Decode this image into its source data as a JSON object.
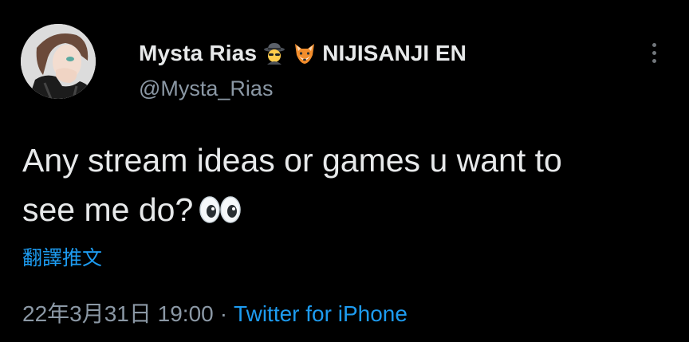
{
  "author": {
    "display_name": "Mysta Rias",
    "name_emojis": [
      "detective-emoji-icon",
      "fox-emoji-icon"
    ],
    "name_suffix": "NIJISANJI EN",
    "handle": "@Mysta_Rias"
  },
  "tweet": {
    "text_line1": "Any stream ideas or games u want to",
    "text_line2": "see me do?",
    "trailing_emoji": "eyes-emoji-icon"
  },
  "translate_label": "翻譯推文",
  "meta": {
    "timestamp": "22年3月31日 19:00",
    "separator": "·",
    "source": "Twitter for iPhone"
  },
  "colors": {
    "background": "#000000",
    "text": "#e7e9ea",
    "secondary": "#8b98a5",
    "link": "#1d9bf0"
  }
}
